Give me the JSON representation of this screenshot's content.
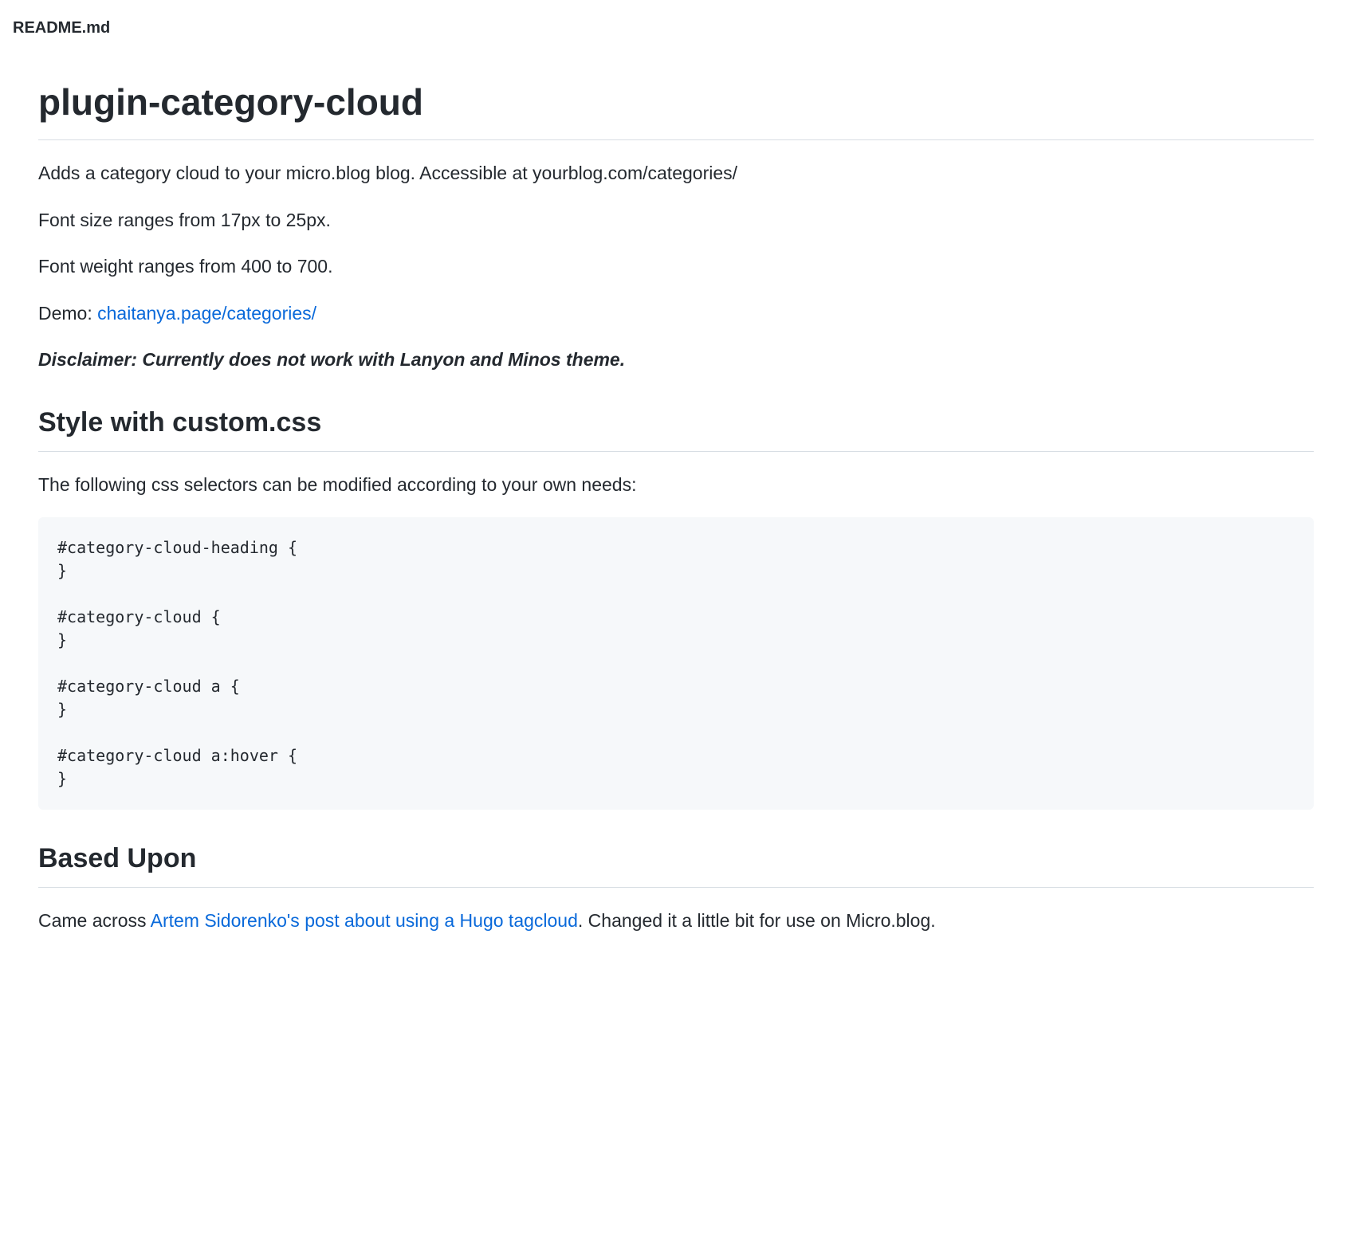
{
  "file_header": "README.md",
  "title": "plugin-category-cloud",
  "intro": {
    "p1": "Adds a category cloud to your micro.blog blog. Accessible at yourblog.com/categories/",
    "p2": "Font size ranges from 17px to 25px.",
    "p3": "Font weight ranges from 400 to 700.",
    "demo_label": "Demo: ",
    "demo_link": "chaitanya.page/categories/",
    "disclaimer": "Disclaimer: Currently does not work with Lanyon and Minos theme."
  },
  "style_section": {
    "heading": "Style with custom.css",
    "intro": "The following css selectors can be modified according to your own needs:",
    "code": "#category-cloud-heading {\n}\n\n#category-cloud {\n}\n\n#category-cloud a {\n}\n\n#category-cloud a:hover {\n}"
  },
  "based_upon": {
    "heading": "Based Upon",
    "text_before": "Came across ",
    "link_text": "Artem Sidorenko's post about using a Hugo tagcloud",
    "text_after": ". Changed it a little bit for use on Micro.blog."
  }
}
